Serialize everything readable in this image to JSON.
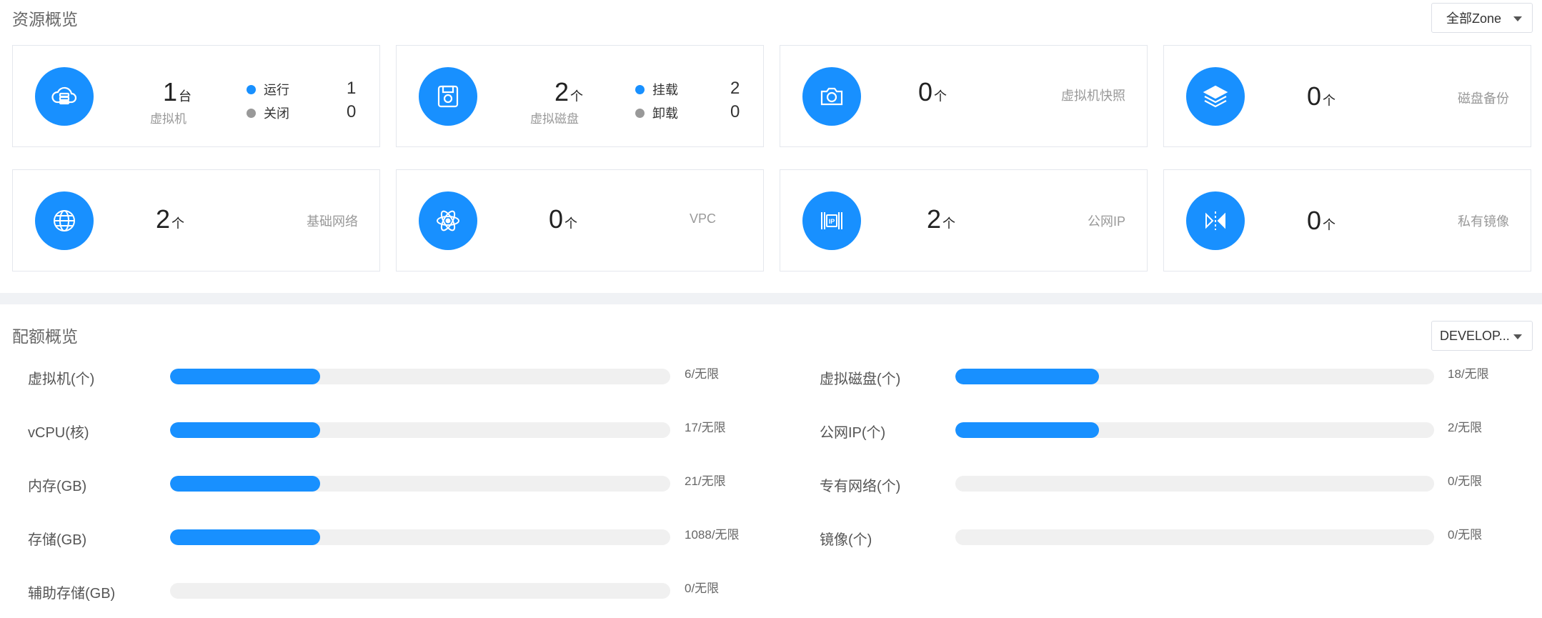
{
  "resource_overview": {
    "title": "资源概览",
    "zone_select": {
      "value": "全部Zone"
    },
    "cards": {
      "vm": {
        "count": "1",
        "unit": "台",
        "label": "虚拟机",
        "status": [
          {
            "label": "运行",
            "value": "1",
            "color": "#1890ff"
          },
          {
            "label": "关闭",
            "value": "0",
            "color": "#999999"
          }
        ]
      },
      "disk": {
        "count": "2",
        "unit": "个",
        "label": "虚拟磁盘",
        "status": [
          {
            "label": "挂载",
            "value": "2",
            "color": "#1890ff"
          },
          {
            "label": "卸载",
            "value": "0",
            "color": "#999999"
          }
        ]
      },
      "snapshot": {
        "count": "0",
        "unit": "个",
        "label": "虚拟机快照"
      },
      "backup": {
        "count": "0",
        "unit": "个",
        "label": "磁盘备份"
      },
      "network": {
        "count": "2",
        "unit": "个",
        "label": "基础网络"
      },
      "vpc": {
        "count": "0",
        "unit": "个",
        "label": "VPC"
      },
      "public_ip": {
        "count": "2",
        "unit": "个",
        "label": "公网IP"
      },
      "image": {
        "count": "0",
        "unit": "个",
        "label": "私有镜像"
      }
    }
  },
  "quota_overview": {
    "title": "配额概览",
    "project_select": {
      "value": "DEVELOP..."
    },
    "left": [
      {
        "label": "虚拟机(个)",
        "value": "6/无限",
        "fill": 0.3
      },
      {
        "label": "vCPU(核)",
        "value": "17/无限",
        "fill": 0.3
      },
      {
        "label": "内存(GB)",
        "value": "21/无限",
        "fill": 0.3
      },
      {
        "label": "存储(GB)",
        "value": "1088/无限",
        "fill": 0.3
      },
      {
        "label": "辅助存储(GB)",
        "value": "0/无限",
        "fill": 0
      }
    ],
    "right": [
      {
        "label": "虚拟磁盘(个)",
        "value": "18/无限",
        "fill": 0.3
      },
      {
        "label": "公网IP(个)",
        "value": "2/无限",
        "fill": 0.3
      },
      {
        "label": "专有网络(个)",
        "value": "0/无限",
        "fill": 0
      },
      {
        "label": "镜像(个)",
        "value": "0/无限",
        "fill": 0
      }
    ]
  },
  "colors": {
    "accent": "#1890ff",
    "track": "#f0f0f0",
    "inactive_dot": "#999999"
  }
}
